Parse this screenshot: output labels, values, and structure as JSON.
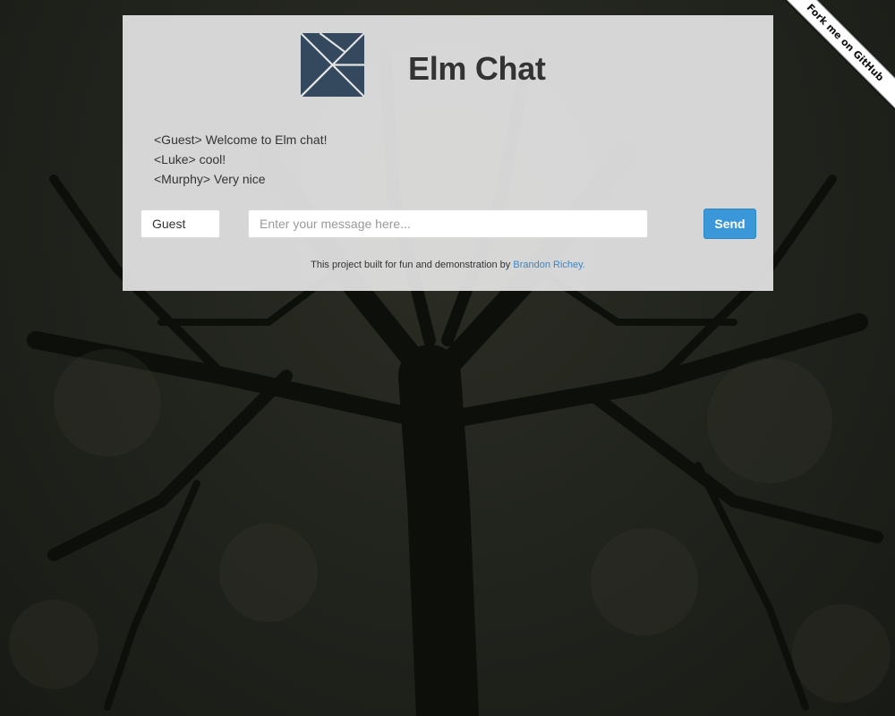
{
  "app": {
    "title": "Elm Chat",
    "logo_icon": "tangram-icon",
    "logo_color": "#34495e"
  },
  "messages": [
    {
      "text": "<Guest> Welcome to Elm chat!"
    },
    {
      "text": "<Luke> cool!"
    },
    {
      "text": "<Murphy> Very nice"
    }
  ],
  "form": {
    "name_value": "Guest",
    "message_value": "",
    "message_placeholder": "Enter your message here...",
    "send_label": "Send",
    "accent_color": "#3a97d8"
  },
  "footer": {
    "text": "This project built for fun and demonstration by ",
    "author_link": "Brandon Richey."
  },
  "ribbon": {
    "label": "Fork me on GitHub"
  }
}
